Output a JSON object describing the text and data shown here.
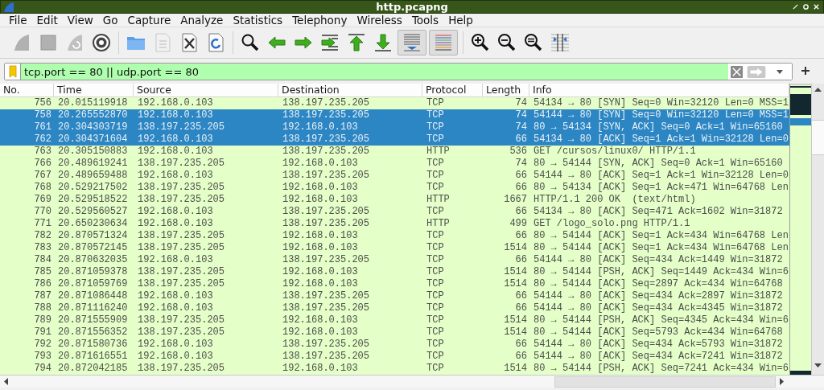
{
  "window": {
    "title": "http.pcapng"
  },
  "menu": [
    "File",
    "Edit",
    "View",
    "Go",
    "Capture",
    "Analyze",
    "Statistics",
    "Telephony",
    "Wireless",
    "Tools",
    "Help"
  ],
  "toolbar": [
    {
      "kind": "start",
      "disabled": true,
      "pressed": false
    },
    {
      "kind": "stop",
      "disabled": true,
      "pressed": false
    },
    {
      "kind": "restart",
      "disabled": true,
      "pressed": false
    },
    {
      "kind": "options",
      "disabled": false,
      "pressed": false
    },
    {
      "kind": "separator"
    },
    {
      "kind": "open",
      "disabled": false,
      "pressed": false
    },
    {
      "kind": "save",
      "disabled": true,
      "pressed": false
    },
    {
      "kind": "close",
      "disabled": false,
      "pressed": false
    },
    {
      "kind": "reload",
      "disabled": false,
      "pressed": false
    },
    {
      "kind": "separator"
    },
    {
      "kind": "find",
      "disabled": false,
      "pressed": false
    },
    {
      "kind": "back",
      "disabled": false,
      "pressed": false
    },
    {
      "kind": "forward",
      "disabled": false,
      "pressed": false
    },
    {
      "kind": "goto",
      "disabled": false,
      "pressed": false
    },
    {
      "kind": "first",
      "disabled": false,
      "pressed": false
    },
    {
      "kind": "last",
      "disabled": false,
      "pressed": false
    },
    {
      "kind": "autoscroll",
      "disabled": false,
      "pressed": true
    },
    {
      "kind": "colorize",
      "disabled": false,
      "pressed": true
    },
    {
      "kind": "separator"
    },
    {
      "kind": "zoom-in",
      "disabled": false,
      "pressed": false
    },
    {
      "kind": "zoom-out",
      "disabled": false,
      "pressed": false
    },
    {
      "kind": "zoom-reset",
      "disabled": false,
      "pressed": false
    },
    {
      "kind": "resize-columns",
      "disabled": false,
      "pressed": false
    }
  ],
  "filter": {
    "value": "tcp.port == 80 || udp.port == 80"
  },
  "table": {
    "columns": [
      "No.",
      "Time",
      "Source",
      "Destination",
      "Protocol",
      "Length",
      "Info"
    ],
    "rows": [
      {
        "cells": [
          "756",
          "20.015119918",
          "192.168.0.103",
          "138.197.235.205",
          "TCP",
          "74",
          "54134 → 80 [SYN] Seq=0 Win=32120 Len=0 MSS=1"
        ],
        "selected": false
      },
      {
        "cells": [
          "758",
          "20.265552870",
          "192.168.0.103",
          "138.197.235.205",
          "TCP",
          "74",
          "54144 → 80 [SYN] Seq=0 Win=32120 Len=0 MSS=1"
        ],
        "selected": true
      },
      {
        "cells": [
          "761",
          "20.304303719",
          "138.197.235.205",
          "192.168.0.103",
          "TCP",
          "74",
          "80 → 54134 [SYN, ACK] Seq=0 Ack=1 Win=65160"
        ],
        "selected": true
      },
      {
        "cells": [
          "762",
          "20.304371604",
          "192.168.0.103",
          "138.197.235.205",
          "TCP",
          "66",
          "54134 → 80 [ACK] Seq=1 Ack=1 Win=32128 Len=0"
        ],
        "selected": true
      },
      {
        "cells": [
          "763",
          "20.305150883",
          "192.168.0.103",
          "138.197.235.205",
          "HTTP",
          "536",
          "GET /cursos/linux0/ HTTP/1.1"
        ],
        "selected": false
      },
      {
        "cells": [
          "766",
          "20.489619241",
          "138.197.235.205",
          "192.168.0.103",
          "TCP",
          "74",
          "80 → 54144 [SYN, ACK] Seq=0 Ack=1 Win=65160"
        ],
        "selected": false
      },
      {
        "cells": [
          "767",
          "20.489659488",
          "192.168.0.103",
          "138.197.235.205",
          "TCP",
          "66",
          "54144 → 80 [ACK] Seq=1 Ack=1 Win=32128 Len=0"
        ],
        "selected": false
      },
      {
        "cells": [
          "768",
          "20.529217502",
          "138.197.235.205",
          "192.168.0.103",
          "TCP",
          "66",
          "80 → 54134 [ACK] Seq=1 Ack=471 Win=64768 Len"
        ],
        "selected": false
      },
      {
        "cells": [
          "769",
          "20.529518522",
          "138.197.235.205",
          "192.168.0.103",
          "HTTP",
          "1667",
          "HTTP/1.1 200 OK  (text/html)"
        ],
        "selected": false
      },
      {
        "cells": [
          "770",
          "20.529560527",
          "192.168.0.103",
          "138.197.235.205",
          "TCP",
          "66",
          "54134 → 80 [ACK] Seq=471 Ack=1602 Win=31872"
        ],
        "selected": false
      },
      {
        "cells": [
          "771",
          "20.650230634",
          "192.168.0.103",
          "138.197.235.205",
          "HTTP",
          "499",
          "GET /logo_solo.png HTTP/1.1"
        ],
        "selected": false
      },
      {
        "cells": [
          "782",
          "20.870571324",
          "138.197.235.205",
          "192.168.0.103",
          "TCP",
          "66",
          "80 → 54144 [ACK] Seq=1 Ack=434 Win=64768 Len"
        ],
        "selected": false
      },
      {
        "cells": [
          "783",
          "20.870572145",
          "138.197.235.205",
          "192.168.0.103",
          "TCP",
          "1514",
          "80 → 54144 [ACK] Seq=1 Ack=434 Win=64768 Len"
        ],
        "selected": false
      },
      {
        "cells": [
          "784",
          "20.870632035",
          "192.168.0.103",
          "138.197.235.205",
          "TCP",
          "66",
          "54144 → 80 [ACK] Seq=434 Ack=1449 Win=31872"
        ],
        "selected": false
      },
      {
        "cells": [
          "785",
          "20.871059378",
          "138.197.235.205",
          "192.168.0.103",
          "TCP",
          "1514",
          "80 → 54144 [PSH, ACK] Seq=1449 Ack=434 Win=6"
        ],
        "selected": false
      },
      {
        "cells": [
          "786",
          "20.871059769",
          "138.197.235.205",
          "192.168.0.103",
          "TCP",
          "1514",
          "80 → 54144 [ACK] Seq=2897 Ack=434 Win=64768"
        ],
        "selected": false
      },
      {
        "cells": [
          "787",
          "20.871086448",
          "192.168.0.103",
          "138.197.235.205",
          "TCP",
          "66",
          "54144 → 80 [ACK] Seq=434 Ack=2897 Win=31872"
        ],
        "selected": false
      },
      {
        "cells": [
          "788",
          "20.871116240",
          "192.168.0.103",
          "138.197.235.205",
          "TCP",
          "66",
          "54144 → 80 [ACK] Seq=434 Ack=4345 Win=31872"
        ],
        "selected": false
      },
      {
        "cells": [
          "789",
          "20.871555909",
          "138.197.235.205",
          "192.168.0.103",
          "TCP",
          "1514",
          "80 → 54144 [PSH, ACK] Seq=4345 Ack=434 Win=6"
        ],
        "selected": false
      },
      {
        "cells": [
          "791",
          "20.871556352",
          "138.197.235.205",
          "192.168.0.103",
          "TCP",
          "1514",
          "80 → 54144 [ACK] Seq=5793 Ack=434 Win=64768"
        ],
        "selected": false
      },
      {
        "cells": [
          "792",
          "20.871580736",
          "192.168.0.103",
          "138.197.235.205",
          "TCP",
          "66",
          "54144 → 80 [ACK] Seq=434 Ack=5793 Win=31872"
        ],
        "selected": false
      },
      {
        "cells": [
          "793",
          "20.871616551",
          "192.168.0.103",
          "138.197.235.205",
          "TCP",
          "66",
          "54144 → 80 [ACK] Seq=434 Ack=7241 Win=31872"
        ],
        "selected": false
      },
      {
        "cells": [
          "794",
          "20.872042185",
          "138.197.235.205",
          "192.168.0.103",
          "TCP",
          "1514",
          "80 → 54144 [PSH, ACK] Seq=7241 Ack=434 Win=6"
        ],
        "selected": false
      }
    ]
  }
}
